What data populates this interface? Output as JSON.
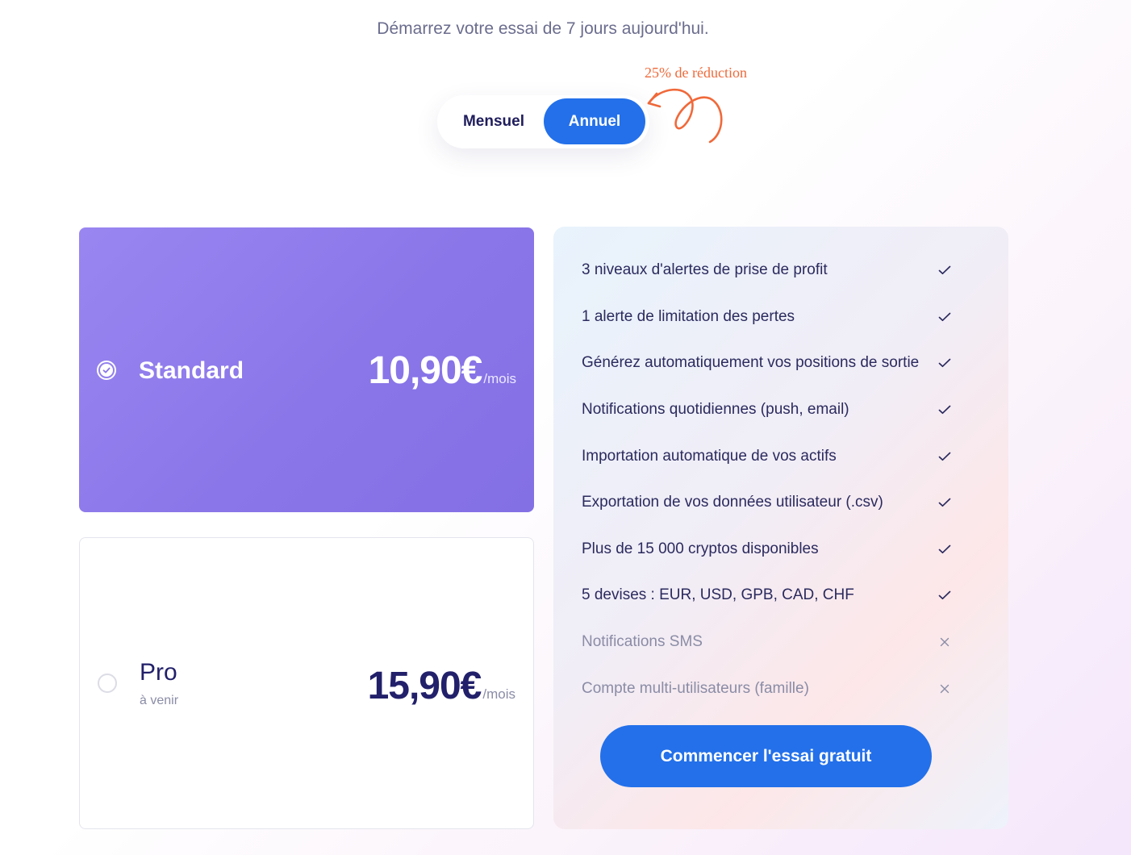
{
  "header": {
    "subtitle": "Démarrez votre essai de 7 jours aujourd'hui.",
    "discount_note": "25% de réduction"
  },
  "billing_toggle": {
    "monthly_label": "Mensuel",
    "annual_label": "Annuel",
    "selected": "Annuel"
  },
  "plans": [
    {
      "name": "Standard",
      "subtitle": "",
      "price": "10,90€",
      "period": "/mois",
      "selected": true
    },
    {
      "name": "Pro",
      "subtitle": "à venir",
      "price": "15,90€",
      "period": "/mois",
      "selected": false
    }
  ],
  "features": [
    {
      "label": "3 niveaux d'alertes de prise de profit",
      "included": true,
      "icon": "check-icon"
    },
    {
      "label": "1 alerte de limitation des pertes",
      "included": true,
      "icon": "check-icon"
    },
    {
      "label": "Générez automatiquement vos positions de sortie",
      "included": true,
      "icon": "check-icon"
    },
    {
      "label": "Notifications quotidiennes (push, email)",
      "included": true,
      "icon": "check-icon"
    },
    {
      "label": "Importation automatique de vos actifs",
      "included": true,
      "icon": "check-icon"
    },
    {
      "label": "Exportation de vos données utilisateur (.csv)",
      "included": true,
      "icon": "check-icon"
    },
    {
      "label": "Plus de 15 000 cryptos disponibles",
      "included": true,
      "icon": "check-icon"
    },
    {
      "label": "5 devises : EUR, USD, GPB, CAD, CHF",
      "included": true,
      "icon": "check-icon"
    },
    {
      "label": "Notifications SMS",
      "included": false,
      "icon": "cross-icon"
    },
    {
      "label": "Compte multi-utilisateurs (famille)",
      "included": false,
      "icon": "cross-icon"
    }
  ],
  "cta_label": "Commencer l'essai gratuit",
  "colors": {
    "accent": "#2370ea",
    "discount": "#f0693a",
    "selected_plan": "#8a76e8",
    "text_dark": "#1f1d5c"
  }
}
